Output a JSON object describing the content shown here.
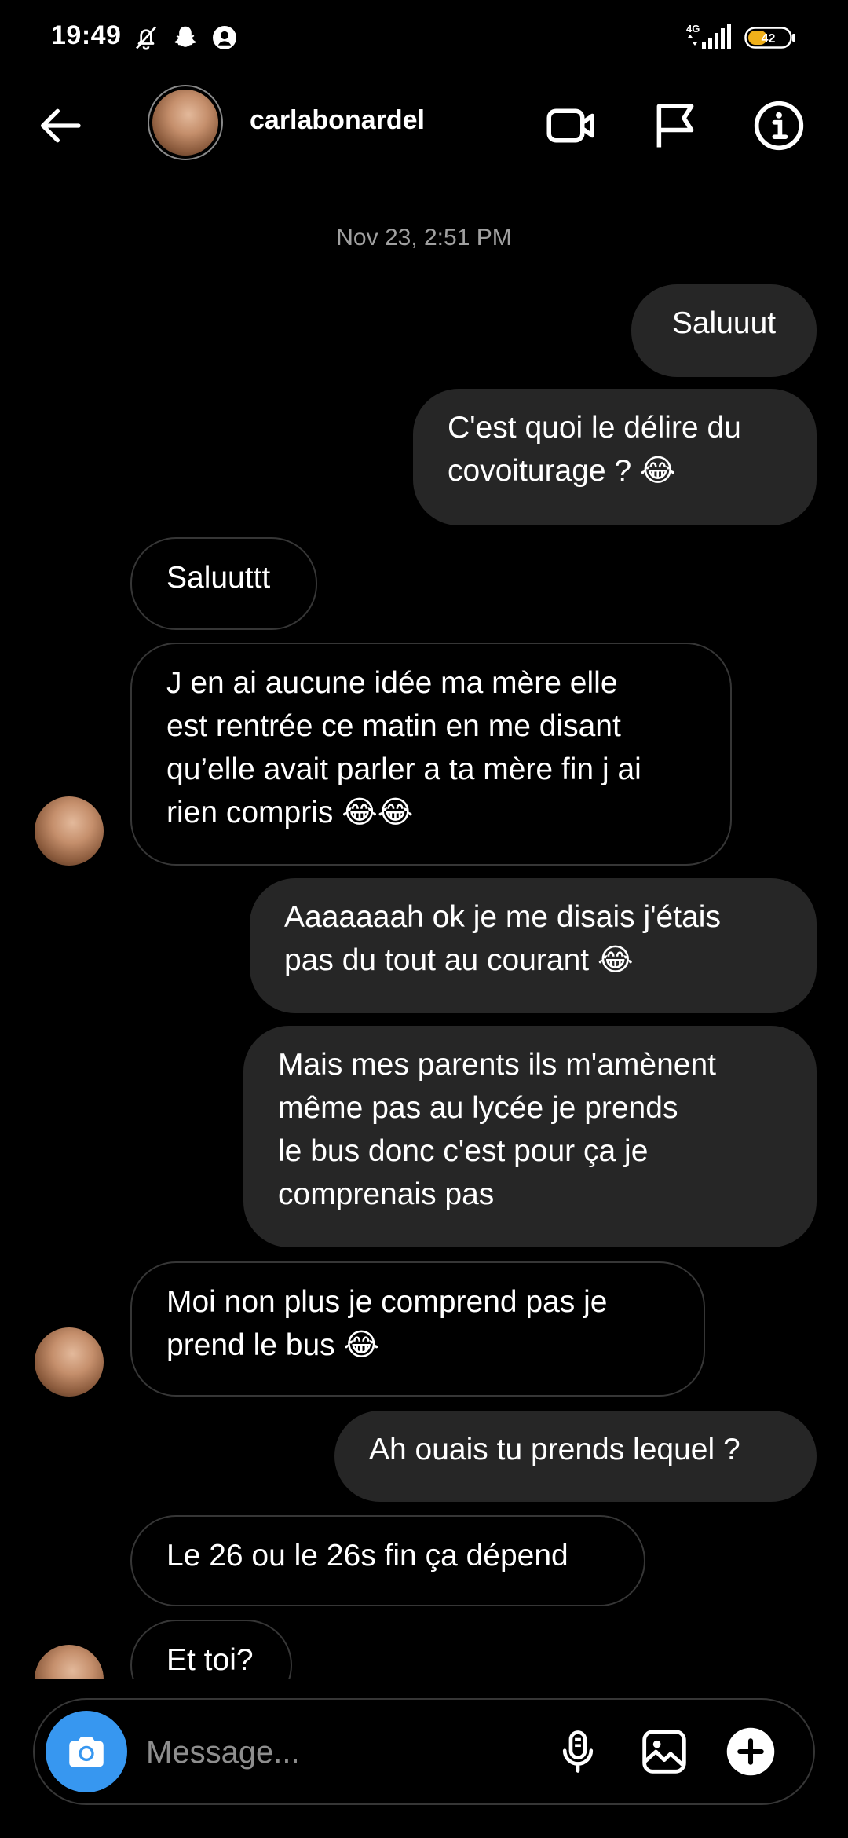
{
  "status_bar": {
    "time": "19:49",
    "network": "4G",
    "battery": "42"
  },
  "header": {
    "username": "carlabonardel"
  },
  "thread": {
    "timestamp": "Nov 23, 2:51 PM",
    "messages": [
      {
        "from": "me",
        "text": "Saluuut"
      },
      {
        "from": "me",
        "text": "C'est quoi le délire du\ncovoiturage ? 😂"
      },
      {
        "from": "them",
        "text": "Saluuttt"
      },
      {
        "from": "them",
        "text": "J en ai aucune idée ma mère elle\nest rentrée ce matin en me disant\nqu’elle avait parler a ta mère fin j ai\nrien compris 😂😂"
      },
      {
        "from": "me",
        "text": "Aaaaaaah ok je me disais j'étais\npas du tout au courant 😂"
      },
      {
        "from": "me",
        "text": "Mais mes parents ils m'amènent\nmême pas au lycée je prends\nle bus donc c'est pour ça je\ncomprenais pas"
      },
      {
        "from": "them",
        "text": "Moi non plus je comprend pas je\nprend le bus 😂"
      },
      {
        "from": "me",
        "text": "Ah ouais tu prends lequel ?"
      },
      {
        "from": "them",
        "text": "Le 26 ou le 26s fin ça dépend"
      },
      {
        "from": "them",
        "text": "Et toi?"
      }
    ]
  },
  "composer": {
    "placeholder": "Message..."
  },
  "colors": {
    "accent": "#3797f0",
    "outgoing_bubble": "#262626",
    "incoming_border": "#363636",
    "background": "#000000",
    "timestamp": "#a0a0a0"
  },
  "icons": [
    "back-arrow-icon",
    "video-call-icon",
    "flag-icon",
    "info-icon",
    "camera-icon",
    "microphone-icon",
    "gallery-icon",
    "plus-icon",
    "mute-icon",
    "snapchat-icon",
    "status-icon"
  ]
}
